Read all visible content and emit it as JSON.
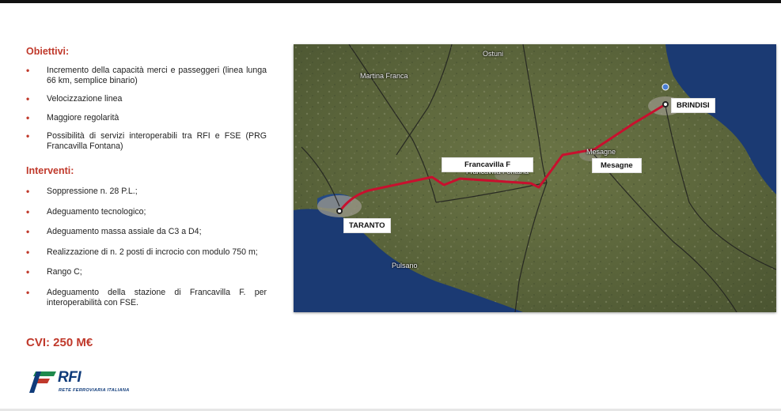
{
  "objectives": {
    "heading": "Obiettivi:",
    "items": [
      "Incremento della capacità merci e passeggeri (linea lunga 66 km, semplice binario)",
      "Velocizzazione linea",
      "Maggiore regolarità",
      "Possibilità di servizi interoperabili tra RFI e FSE  (PRG Francavilla Fontana)"
    ]
  },
  "interventions": {
    "heading": "Interventi:",
    "items": [
      "Soppressione n. 28 P.L.;",
      "Adeguamento tecnologico;",
      "Adeguamento massa assiale da C3 a D4;",
      "Realizzazione di n. 2 posti di incrocio con modulo 750 m;",
      "Rango C;",
      "Adeguamento della stazione di Francavilla F. per interoperabilità con FSE."
    ]
  },
  "cvi": "CVI: 250 M€",
  "bullet_glyph": "•",
  "logo": {
    "name": "RFI",
    "subtitle": "RETE FERROVIARIA ITALIANA",
    "colors": {
      "blue": "#0f3b7a",
      "red": "#c0392b",
      "green": "#1e8a4c"
    }
  },
  "map": {
    "towns": {
      "ostuni": "Ostuni",
      "martina_franca": "Martina Franca",
      "francavilla_fontana": "Francavilla Fontana",
      "mesagne": "Mesagne",
      "pulsano": "Pulsano"
    },
    "stations": {
      "brindisi": "BRINDISI",
      "francavilla": "Francavilla F",
      "mesagne": "Mesagne",
      "taranto": "TARANTO"
    },
    "route_color": "#c8102e",
    "sea_color": "#1b3a73",
    "land_color": "#5e6a3d"
  },
  "accent_color": "#c0392b"
}
